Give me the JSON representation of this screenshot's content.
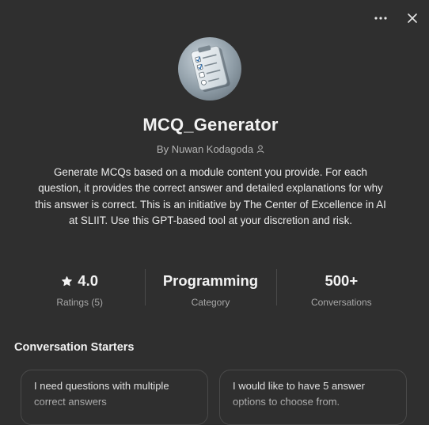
{
  "header": {
    "more_icon": "more-horizontal-icon",
    "close_icon": "close-icon"
  },
  "gpt": {
    "name": "MCQ_Generator",
    "author_line": "By Nuwan Kodagoda",
    "avatar": "mcq-checklist-avatar",
    "description": "Generate MCQs based on a module content you provide. For each question, it provides the correct answer and detailed explanations for why this answer is correct. This is an initiative by The Center of Excellence in AI at SLIIT. Use this GPT-based tool at your discretion and risk."
  },
  "stats": [
    {
      "value": "4.0",
      "label": "Ratings (5)",
      "icon": "star-icon"
    },
    {
      "value": "Programming",
      "label": "Category"
    },
    {
      "value": "500+",
      "label": "Conversations"
    }
  ],
  "conversation_starters": {
    "title": "Conversation Starters",
    "items": [
      {
        "text": "I need questions with multiple correct answers"
      },
      {
        "text": "I would like to have 5 answer options to choose from."
      }
    ]
  },
  "colors": {
    "background": "#2f2f2f",
    "text_primary": "#ececec",
    "text_secondary": "#b4b4b4",
    "divider": "#4a4a4a"
  }
}
